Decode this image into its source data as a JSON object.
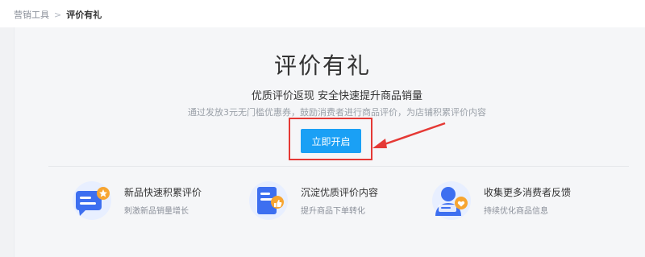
{
  "breadcrumb": {
    "parent": "营销工具",
    "separator": ">",
    "current": "评价有礼"
  },
  "hero": {
    "title": "评价有礼",
    "subtitle": "优质评价返现 安全快速提升商品销量",
    "description": "通过发放3元无门槛优惠券，鼓励消费者进行商品评价，为店铺积累评价内容",
    "cta_label": "立即开启"
  },
  "features": [
    {
      "title": "新品快速积累评价",
      "subtitle": "刺激新品销量增长",
      "icon": "chat-star-icon"
    },
    {
      "title": "沉淀优质评价内容",
      "subtitle": "提升商品下单转化",
      "icon": "document-thumb-icon"
    },
    {
      "title": "收集更多消费者反馈",
      "subtitle": "持续优化商品信息",
      "icon": "user-heart-icon"
    }
  ],
  "colors": {
    "accent": "#1aa0f5",
    "highlight": "#e53935",
    "icon_blue": "#3d6ff0",
    "icon_orange": "#f7a531"
  }
}
